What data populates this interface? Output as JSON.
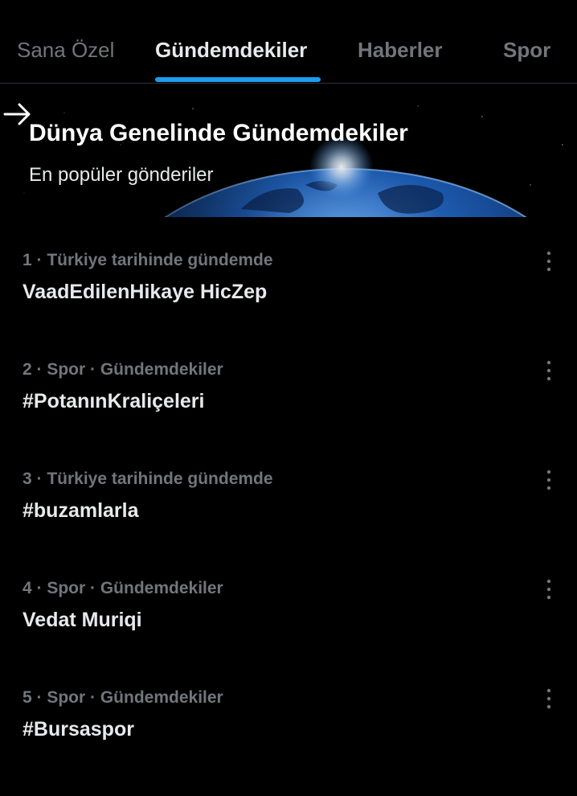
{
  "colors": {
    "background": "#000000",
    "accent": "#1d9bf0",
    "text_primary": "#e7e9ea",
    "text_secondary": "#71767b",
    "divider": "#2f3336"
  },
  "tabs": [
    {
      "label": "Sana Özel",
      "active": false
    },
    {
      "label": "Gündemdekiler",
      "active": true
    },
    {
      "label": "Haberler",
      "active": false
    },
    {
      "label": "Spor",
      "active": false
    }
  ],
  "banner": {
    "title": "Dünya Genelinde Gündemdekiler",
    "subtitle": "En popüler gönderiler",
    "arrow_icon": "arrow-right-icon"
  },
  "trends": [
    {
      "meta": "1 · Türkiye tarihinde gündemde",
      "title": "VaadEdilenHikaye HicZep"
    },
    {
      "meta": "2 · Spor · Gündemdekiler",
      "title": "#PotanınKraliçeleri"
    },
    {
      "meta": "3 · Türkiye tarihinde gündemde",
      "title": "#buzamlarla"
    },
    {
      "meta": "4 · Spor · Gündemdekiler",
      "title": "Vedat Muriqi"
    },
    {
      "meta": "5 · Spor · Gündemdekiler",
      "title": "#Bursaspor"
    }
  ]
}
